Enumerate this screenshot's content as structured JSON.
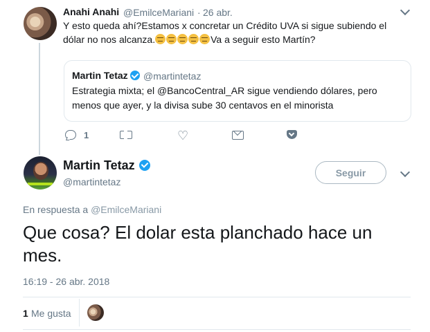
{
  "parent_tweet": {
    "author_name": "Anahi Anahi",
    "author_handle": "@EmilceMariani",
    "separator": "·",
    "date": "26 abr.",
    "text_line1": "Y esto queda ahí?Estamos x concretar un Crédito UVA si sigue subiendo el",
    "text_line2_before": "dólar no nos alcanza.",
    "text_line2_after": "Va a seguir esto Martín?",
    "emoji_icon": "persevering-face-emoji",
    "emoji_count": 5,
    "quoted": {
      "author_name": "Martin Tetaz",
      "author_handle": "@martintetaz",
      "text": "Estrategia mixta; el @BancoCentral_AR sigue vendiendo dólares, pero menos que ayer, y la divisa sube 30 centavos en el minorista"
    },
    "actions": {
      "reply_count": "1",
      "icons": [
        "reply-icon",
        "retweet-icon",
        "heart-icon",
        "mail-icon",
        "pocket-icon"
      ]
    }
  },
  "main_tweet": {
    "author_name": "Martin Tetaz",
    "author_handle": "@martintetaz",
    "follow_label": "Seguir",
    "in_reply_prefix": "En respuesta a",
    "in_reply_handle": "@EmilceMariani",
    "text": "Que cosa? El dolar esta planchado hace un mes.",
    "timestamp": "16:19 - 26 abr. 2018",
    "likes_count": "1",
    "likes_label": "Me gusta"
  },
  "colors": {
    "text": "#14171a",
    "secondary": "#657786",
    "border": "#e1e8ed",
    "verified": "#1da1f2"
  }
}
